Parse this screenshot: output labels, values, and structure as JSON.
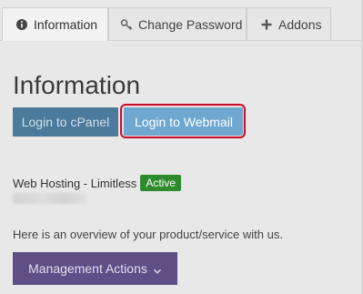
{
  "tabs": [
    {
      "label": "Information",
      "icon": "info-circle-icon",
      "active": true
    },
    {
      "label": "Change Password",
      "icon": "key-icon",
      "active": false
    },
    {
      "label": "Addons",
      "icon": "plus-icon",
      "active": false
    }
  ],
  "page_title": "Information",
  "buttons": {
    "cpanel": "Login to cPanel",
    "webmail": "Login to Webmail"
  },
  "product": {
    "name": "Web Hosting - Limitless",
    "status": "Active"
  },
  "overview_text": "Here is an overview of your product/service with us.",
  "management_button": {
    "label": "Management Actions",
    "icon": "chevron-down-icon"
  },
  "colors": {
    "cpanel_bg": "#4b7a9a",
    "webmail_bg": "#6ea7cf",
    "active_badge": "#2d8a2d",
    "management_bg": "#5f4f86",
    "highlight_ring": "#c8102e"
  }
}
